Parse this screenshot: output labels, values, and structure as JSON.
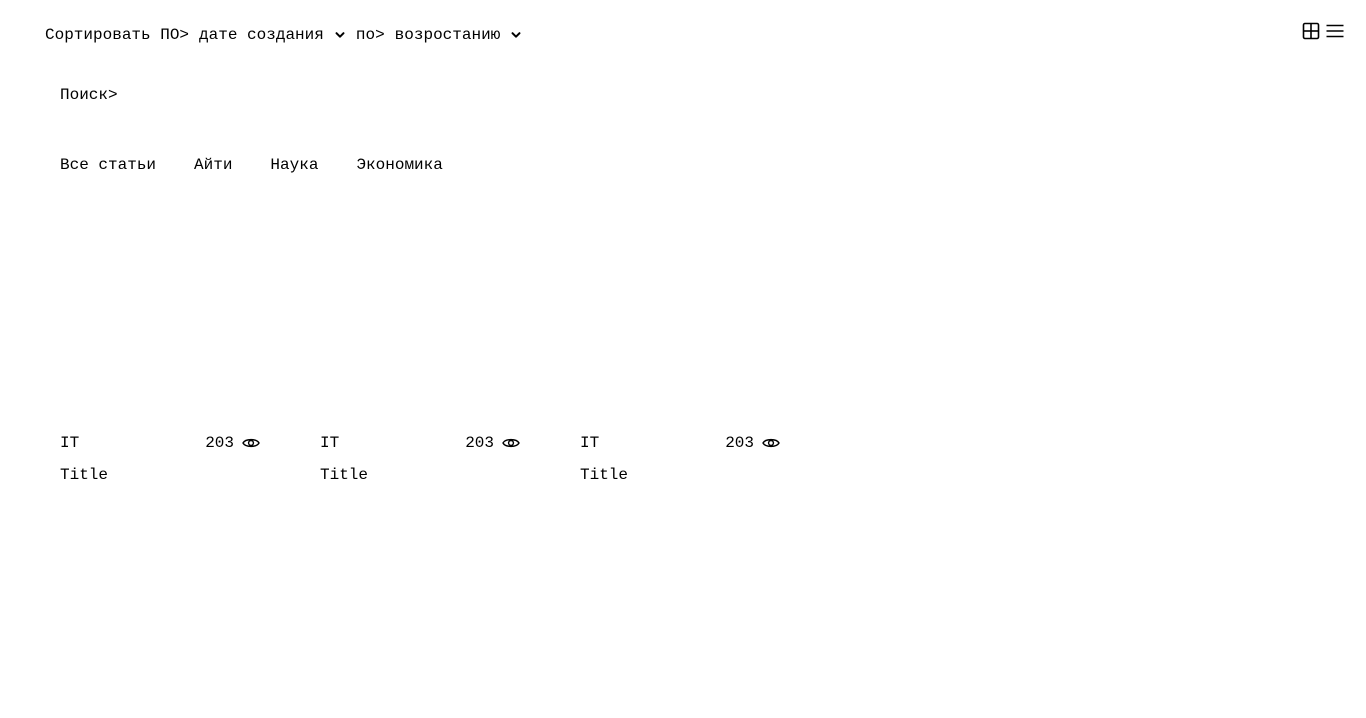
{
  "sort": {
    "label": "Сортировать ПО>",
    "field_value": "дате создания",
    "order_label": "по>",
    "order_value": "возростанию"
  },
  "view_toggle": {
    "grid_icon": "grid-icon",
    "list_icon": "list-icon"
  },
  "search": {
    "label": "Поиск>"
  },
  "tabs": [
    {
      "label": "Все статьи"
    },
    {
      "label": "Айти"
    },
    {
      "label": "Наука"
    },
    {
      "label": "Экономика"
    }
  ],
  "cards": [
    {
      "category": "IT",
      "views": "203",
      "title": "Title"
    },
    {
      "category": "IT",
      "views": "203",
      "title": "Title"
    },
    {
      "category": "IT",
      "views": "203",
      "title": "Title"
    }
  ]
}
